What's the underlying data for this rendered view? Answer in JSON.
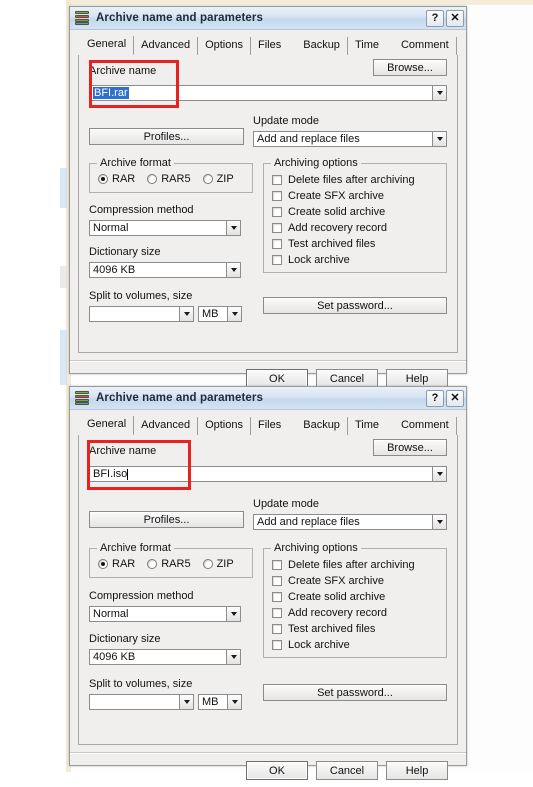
{
  "app": {
    "window_title": "Archive name and parameters",
    "icon": "winrar-books-icon",
    "help_button": "?",
    "close_button": "✕"
  },
  "tabs": [
    {
      "label": "General",
      "active": true
    },
    {
      "label": "Advanced",
      "active": false
    },
    {
      "label": "Options",
      "active": false
    },
    {
      "label": "Files",
      "active": false
    },
    {
      "label": "Backup",
      "active": false
    },
    {
      "label": "Time",
      "active": false
    },
    {
      "label": "Comment",
      "active": false
    }
  ],
  "labels": {
    "archive_name": "Archive name",
    "browse": "Browse...",
    "profiles": "Profiles...",
    "update_mode": "Update mode",
    "archive_format": "Archive format",
    "compression_method": "Compression method",
    "dictionary_size": "Dictionary size",
    "split_to_volumes": "Split to volumes, size",
    "archiving_options": "Archiving options",
    "set_password": "Set password...",
    "size_unit": "MB"
  },
  "values": {
    "update_mode": "Add and replace files",
    "compression_method": "Normal",
    "dictionary_size": "4096 KB",
    "split_size": "",
    "size_unit": "MB"
  },
  "formats": [
    {
      "label": "RAR",
      "selected": true
    },
    {
      "label": "RAR5",
      "selected": false
    },
    {
      "label": "ZIP",
      "selected": false
    }
  ],
  "archiving_options": [
    {
      "label": "Delete files after archiving",
      "checked": false
    },
    {
      "label": "Create SFX archive",
      "checked": false
    },
    {
      "label": "Create solid archive",
      "checked": false
    },
    {
      "label": "Add recovery record",
      "checked": false
    },
    {
      "label": "Test archived files",
      "checked": false
    },
    {
      "label": "Lock archive",
      "checked": false
    }
  ],
  "footer": {
    "ok": "OK",
    "cancel": "Cancel",
    "help": "Help"
  },
  "dialog_top": {
    "archive_name_value": "BFI.rar",
    "archive_name_state": "selected-highlighted"
  },
  "dialog_bottom": {
    "archive_name_value": "BFI.iso",
    "archive_name_state": "caret-at-end"
  },
  "annotation": {
    "color": "#e8221e",
    "shape": "rectangle",
    "target": "archive-name-field"
  }
}
